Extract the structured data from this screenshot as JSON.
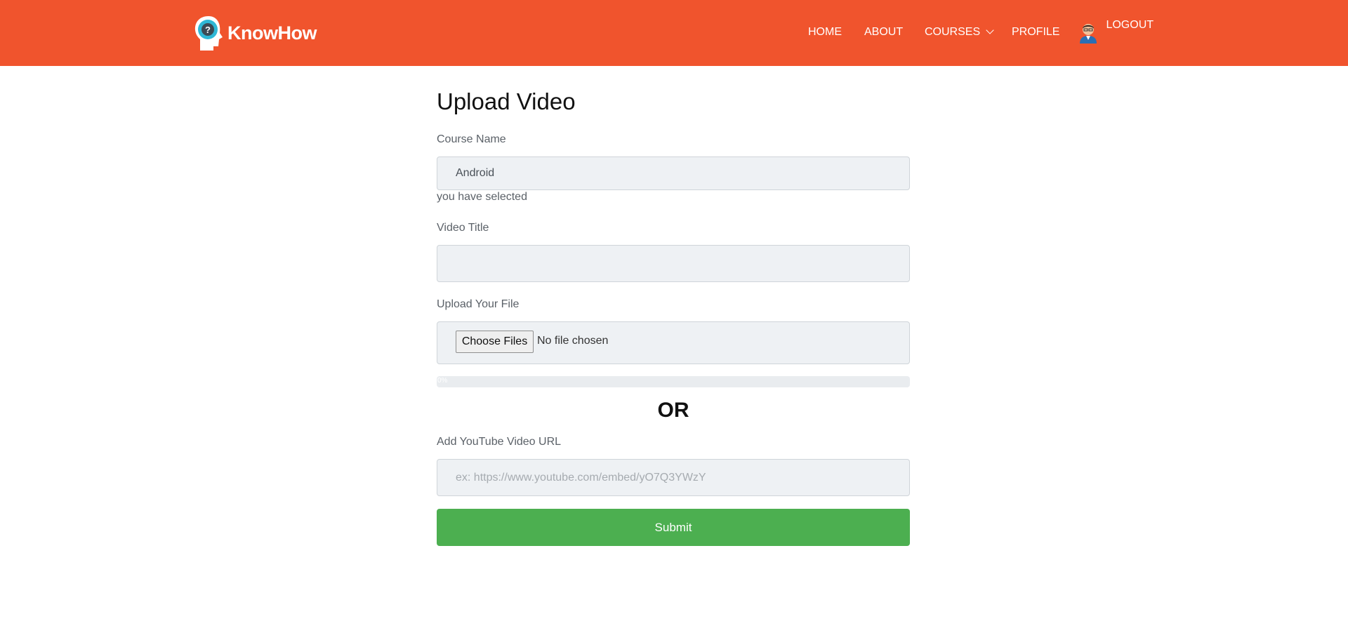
{
  "brand": {
    "name": "KnowHow",
    "logo_icon": "head-question-icon"
  },
  "nav": {
    "home": "HOME",
    "about": "ABOUT",
    "courses": "COURSES",
    "profile": "PROFILE",
    "logout": "LOGOUT",
    "avatar_icon": "user-avatar-icon"
  },
  "form": {
    "title": "Upload Video",
    "course_label": "Course Name",
    "course_value": "Android",
    "course_note": "you have selected",
    "video_title_label": "Video Title",
    "video_title_value": "",
    "upload_label": "Upload Your File",
    "choose_files": "Choose Files",
    "file_status": "No file chosen",
    "progress_text": "0%",
    "progress_value": 0,
    "or_text": "OR",
    "youtube_label": "Add YouTube Video URL",
    "youtube_placeholder": "ex: https://www.youtube.com/embed/yO7Q3YWzY",
    "submit": "Submit"
  },
  "colors": {
    "header": "#f0542d",
    "submit": "#4caf50",
    "field": "#eef1f4"
  }
}
